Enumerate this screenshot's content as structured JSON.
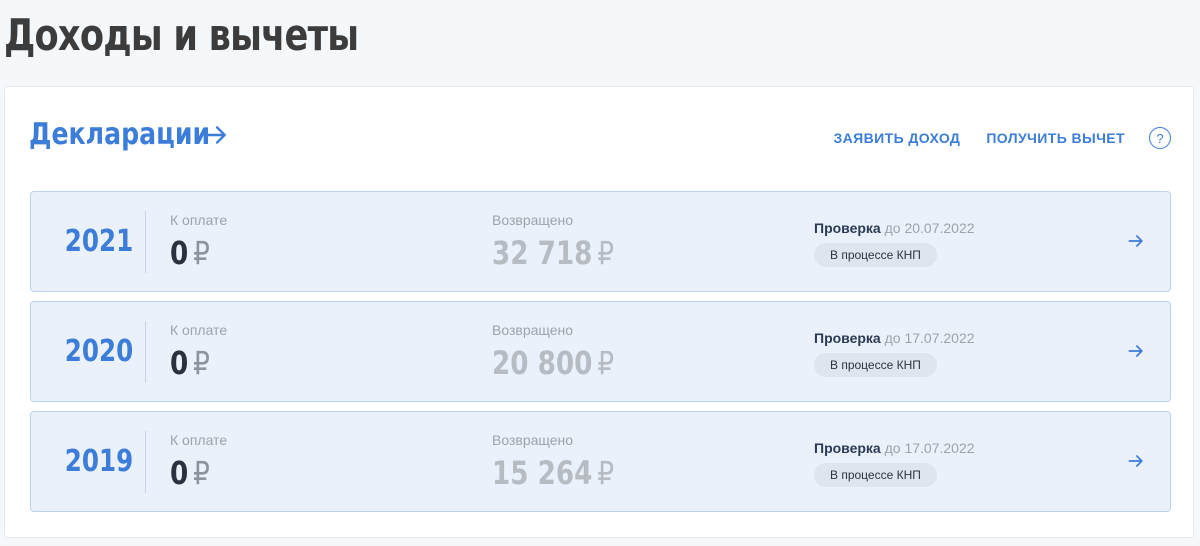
{
  "page": {
    "title": "Доходы и вычеты"
  },
  "declarations": {
    "title": "Декларации",
    "arrow_icon": "arrow-right-icon",
    "actions": {
      "declare_income": "ЗАЯВИТЬ ДОХОД",
      "get_deduction": "ПОЛУЧИТЬ ВЫЧЕТ",
      "help": "?"
    },
    "labels": {
      "to_pay": "К оплате",
      "returned": "Возвращено",
      "check": "Проверка"
    },
    "currency": "₽",
    "rows": [
      {
        "year": "2021",
        "to_pay": "0",
        "returned": "32 718",
        "check_until": "до 20.07.2022",
        "status": "В процессе КНП"
      },
      {
        "year": "2020",
        "to_pay": "0",
        "returned": "20 800",
        "check_until": "до 17.07.2022",
        "status": "В процессе КНП"
      },
      {
        "year": "2019",
        "to_pay": "0",
        "returned": "15 264",
        "check_until": "до 17.07.2022",
        "status": "В процессе КНП"
      }
    ]
  },
  "colors": {
    "accent": "#3b7dd8",
    "row_background": "#eaf1fa",
    "row_border": "#bcd2ee",
    "title_text": "#3c3c3c",
    "badge_background": "#dfe5ec"
  }
}
